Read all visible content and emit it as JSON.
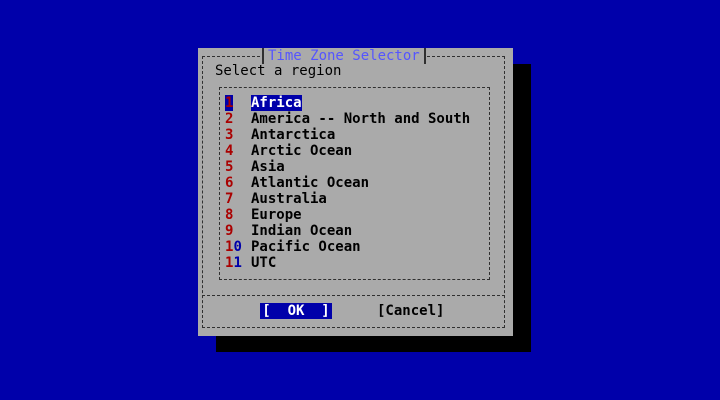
{
  "dialog": {
    "title": "Time Zone Selector",
    "prompt": "Select a region",
    "items": [
      {
        "num": "1",
        "label": "Africa"
      },
      {
        "num": "2",
        "label": "America -- North and South"
      },
      {
        "num": "3",
        "label": "Antarctica"
      },
      {
        "num": "4",
        "label": "Arctic Ocean"
      },
      {
        "num": "5",
        "label": "Asia"
      },
      {
        "num": "6",
        "label": "Atlantic Ocean"
      },
      {
        "num": "7",
        "label": "Australia"
      },
      {
        "num": "8",
        "label": "Europe"
      },
      {
        "num": "9",
        "label": "Indian Ocean"
      },
      {
        "num": "10",
        "label": "Pacific Ocean"
      },
      {
        "num": "11",
        "label": "UTC"
      }
    ],
    "selected_index": 0,
    "ok_label": "[  OK  ]",
    "cancel_label": "[Cancel]"
  },
  "colors": {
    "background": "#0000aa",
    "dialog": "#aaaaaa",
    "highlight": "#0000aa",
    "number": "#aa0000",
    "title": "#5555ff"
  }
}
